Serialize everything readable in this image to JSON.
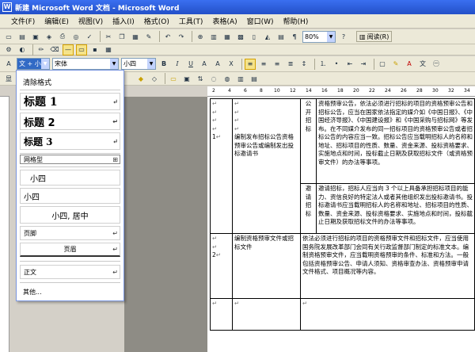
{
  "window": {
    "title": "新建 Microsoft Word 文档 - Microsoft Word"
  },
  "menu": [
    "文件(F)",
    "编辑(E)",
    "视图(V)",
    "插入(I)",
    "格式(O)",
    "工具(T)",
    "表格(A)",
    "窗口(W)",
    "帮助(H)"
  ],
  "toolbar": {
    "zoom": "80%",
    "read_label": "阅读(R)"
  },
  "formatting": {
    "style_value": "文 + 小四",
    "font_value": "宋体",
    "size_value": "小四"
  },
  "ruler": [
    "2",
    "4",
    "6",
    "8",
    "10",
    "12",
    "14",
    "16",
    "18",
    "20",
    "22",
    "24",
    "26",
    "28",
    "30",
    "32",
    "34"
  ],
  "style_panel": {
    "clear": "清除格式",
    "heading1": "标题 1",
    "heading2": "标题 2",
    "heading3": "标题 3",
    "grid": "网格型",
    "xiaosi_indent": "小四",
    "xiaosi": "小四",
    "xiaosi_center": "小四, 居中",
    "footer": "页脚",
    "header": "页眉",
    "body": "正文",
    "more": "其他..."
  },
  "table": {
    "row1": {
      "num": "1",
      "title": "编制发布招标公告资格预审公告或编制发出投标邀请书",
      "sub_a": "公开招标",
      "text_a": "资格预审公告，依法必须进行招标的项目的资格预审公告和招标公告，应当在国家依法指定的媒介如《中国日报》、《中国经济导报》、《中国建设报》和《中国采购与招标网》等发布。在不同媒介发布的同一招标项目的资格预审公告或者招标公告的内容应当一致。招标公告应当载明招标人的名称和地址、招标项目的性质、数量、资金来源、投标资格要求、实施地点和时间，投标截止日期及获取招标文件（或资格预审文件）的办法等事项。",
      "sub_b": "邀请招标",
      "text_b": "邀请招标，招标人应当向 3 个以上具备承担招标项目的能力、资信良好的特定法人或者其他组织发出投标邀请书。投标邀请书应当载明招标人的名称和地址、招标项目的性质、数量、资金来源、投标资格要求、实施地点和时间，投标截止日期及获取招标文件的办法等事项。"
    },
    "row2": {
      "num": "2",
      "title": "编制资格预审文件或招标文件",
      "text": "依法必须进行招标的项目的资格预审文件和招标文件，应当使用国务院发展改革部门会同有关行政监督部门制定的标准文本。编制资格预审文件，应当载明资格预审的条件、标准和方法。一般包括资格预审公告、申请人须知、资格审查办法、资格预审申请文件格式、项目概况等内容。"
    },
    "mark": "↵"
  }
}
